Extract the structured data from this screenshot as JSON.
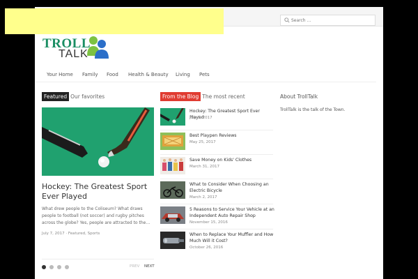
{
  "search": {
    "placeholder": "Search ..."
  },
  "logo": {
    "word1": "TROLL",
    "word2": "TALK"
  },
  "nav": [
    "Your Home",
    "Family",
    "Food",
    "Health & Beauty",
    "Living",
    "Pets"
  ],
  "featured": {
    "tag": "Featured",
    "heading": "Our favorites",
    "title": "Hockey: The Greatest Sport Ever Played",
    "excerpt": "What drew people to the Coliseum? What draws people to football (not soccer) and rugby pitches across the globe? Yes, people are attracted to the…",
    "meta": "July 7, 2017 · Featured, Sports",
    "prev": "PREV",
    "next": "NEXT",
    "slide_count": 4,
    "active_slide": 1
  },
  "blog": {
    "tag": "From the Blog",
    "heading": "The most recent",
    "items": [
      {
        "title": "Hockey: The Greatest Sport Ever Played",
        "date": "July 7, 2017"
      },
      {
        "title": "Best Playpen Reviews",
        "date": "May 25, 2017"
      },
      {
        "title": "Save Money on Kids' Clothes",
        "date": "March 31, 2017"
      },
      {
        "title": "What to Consider When Choosing an Electric Bicycle",
        "date": "March 2, 2017"
      },
      {
        "title": "5 Reasons to Service Your Vehicle at an Independent Auto Repair Shop",
        "date": "November 15, 2016"
      },
      {
        "title": "When to Replace Your Muffler and How Much Will it Cost?",
        "date": "October 26, 2016"
      }
    ]
  },
  "about": {
    "heading": "About TrollTalk",
    "text": "TrollTalk is the talk of the Town."
  },
  "colors": {
    "featured_tag": "#222222",
    "blog_tag": "#e03c31",
    "logo_green": "#1a8e63",
    "field_green": "#20a16f"
  }
}
